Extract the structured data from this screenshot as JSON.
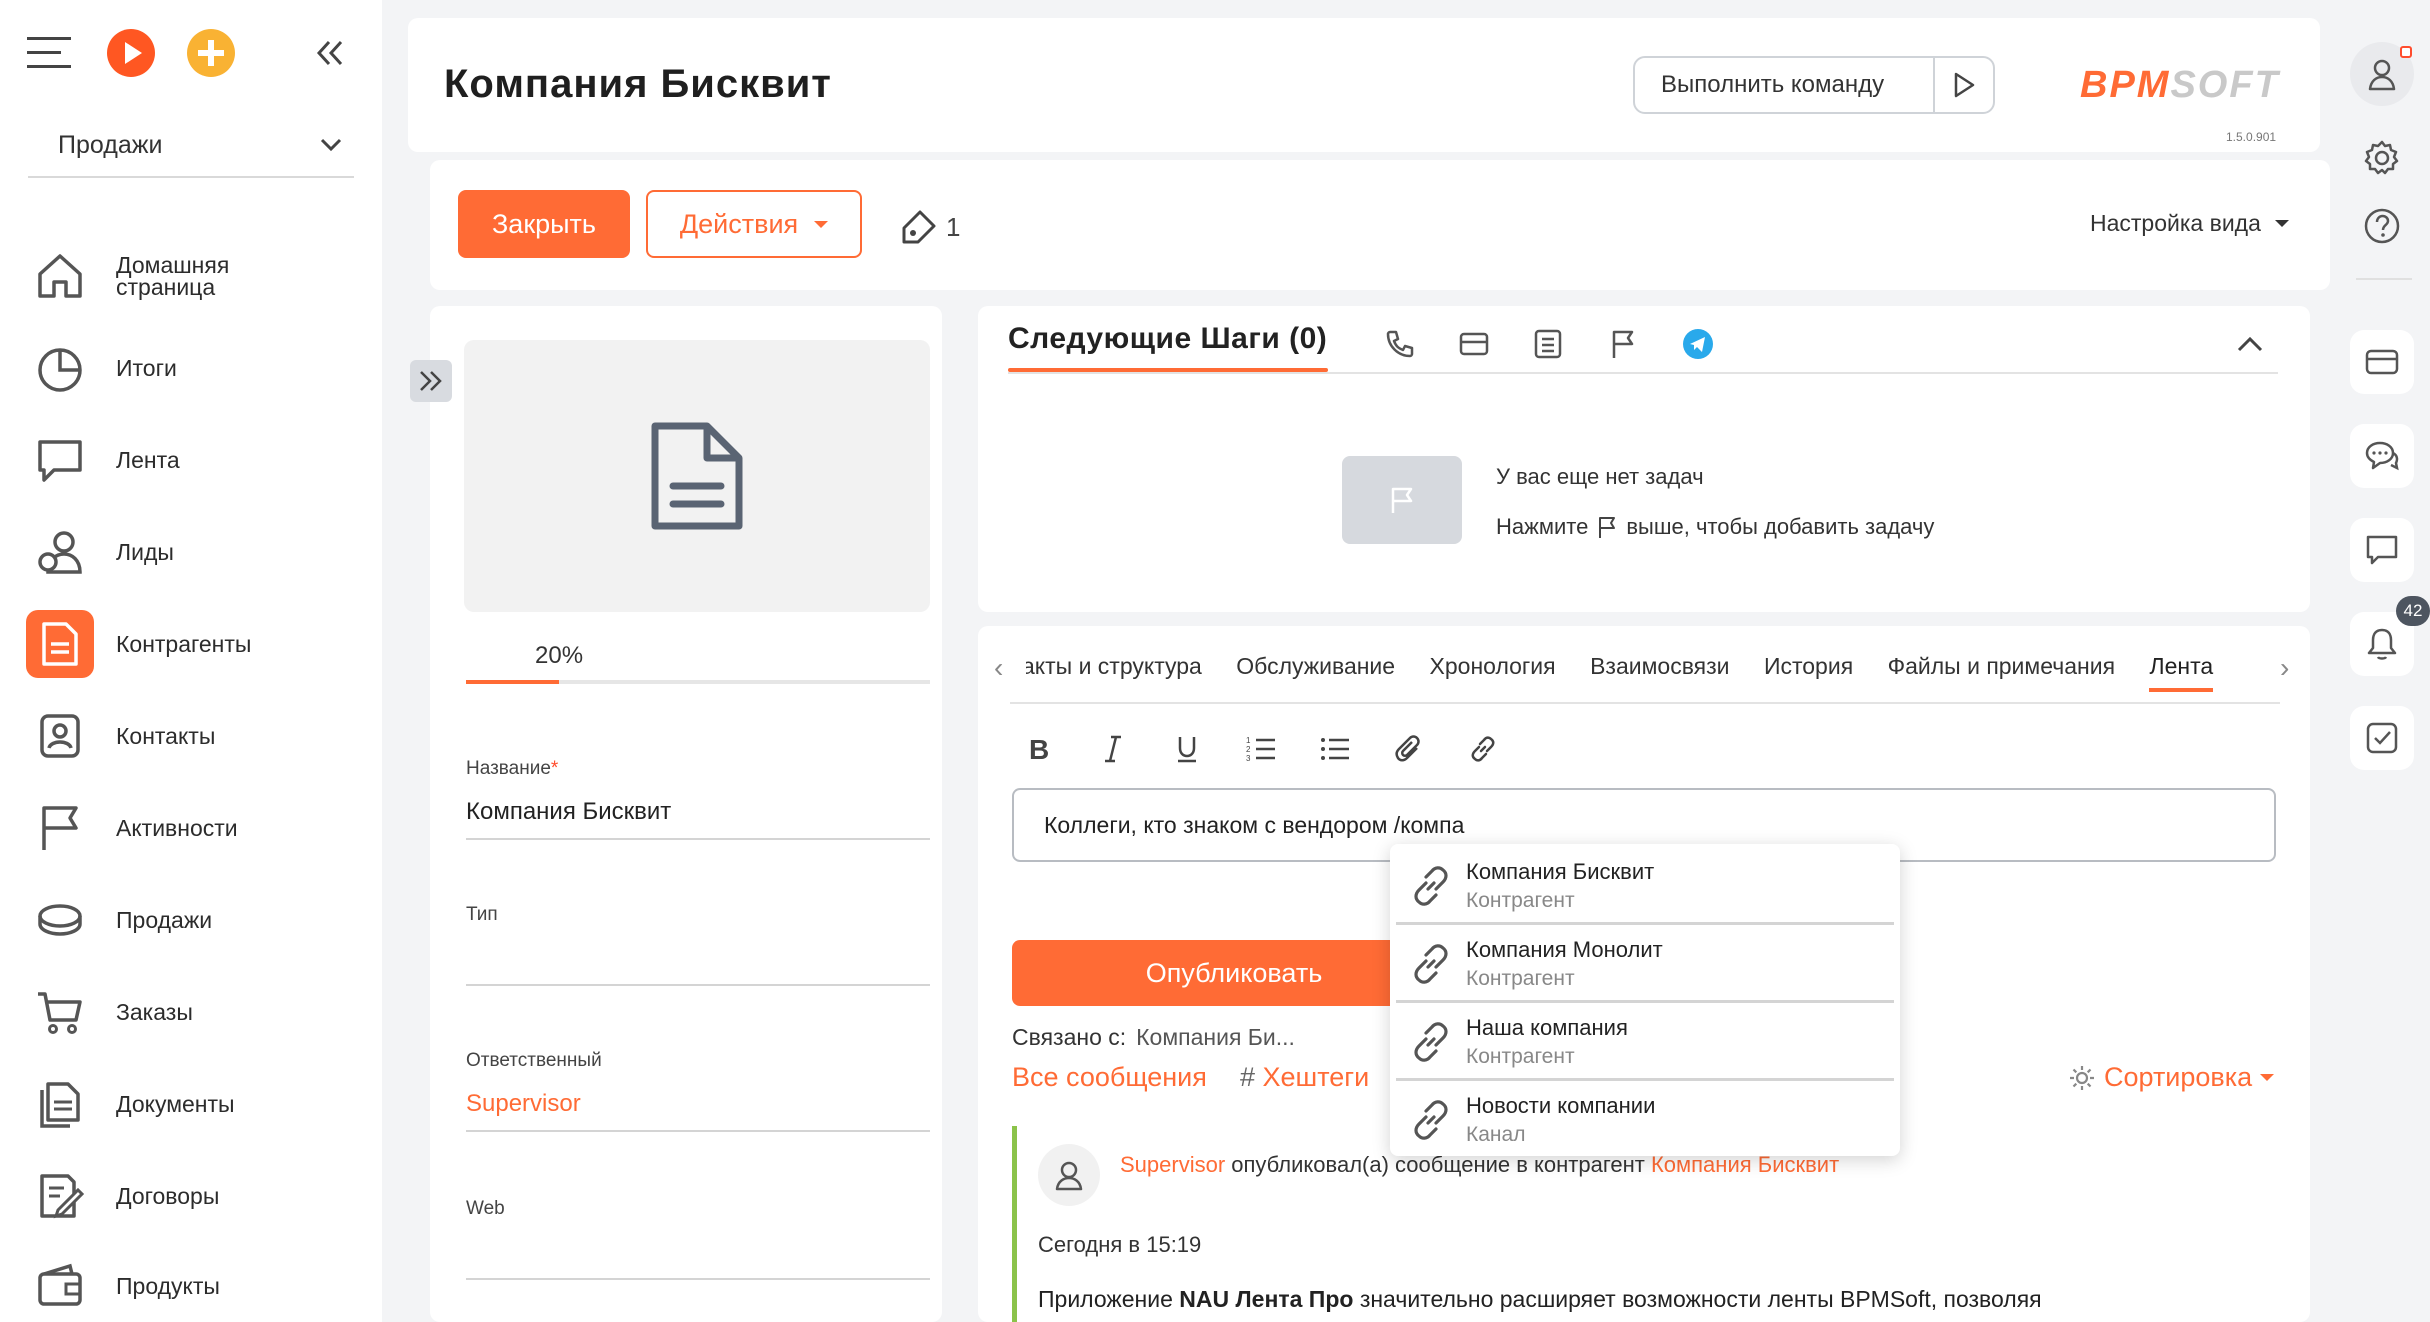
{
  "sidebar": {
    "section_select": "Продажи",
    "items": [
      {
        "label": "Домашняя\nстраница",
        "icon": "home-icon"
      },
      {
        "label": "Итоги",
        "icon": "pie-chart-icon"
      },
      {
        "label": "Лента",
        "icon": "chat-bubble-icon"
      },
      {
        "label": "Лиды",
        "icon": "leads-icon"
      },
      {
        "label": "Контрагенты",
        "icon": "document-icon"
      },
      {
        "label": "Контакты",
        "icon": "contact-card-icon"
      },
      {
        "label": "Активности",
        "icon": "flag-icon"
      },
      {
        "label": "Продажи",
        "icon": "coins-icon"
      },
      {
        "label": "Заказы",
        "icon": "cart-icon"
      },
      {
        "label": "Документы",
        "icon": "documents-icon"
      },
      {
        "label": "Договоры",
        "icon": "contract-icon"
      },
      {
        "label": "Продукты",
        "icon": "wallet-icon"
      }
    ],
    "active_item": "Контрагенты"
  },
  "header": {
    "title": "Компания Бисквит",
    "command_placeholder": "Выполнить команду",
    "logo_part1": "BPM",
    "logo_part2": "SOFT",
    "version": "1.5.0.901"
  },
  "toolbar": {
    "close_label": "Закрыть",
    "actions_label": "Действия",
    "tag_count": "1",
    "view_settings_label": "Настройка вида"
  },
  "profile": {
    "progress_label": "20%",
    "progress_fraction": 0.2,
    "fields": {
      "name_label": "Название",
      "name_value": "Компания Бисквит",
      "type_label": "Тип",
      "type_value": "",
      "owner_label": "Ответственный",
      "owner_value": "Supervisor",
      "web_label": "Web",
      "web_value": ""
    }
  },
  "next_steps": {
    "title": "Следующие Шаги (0)",
    "empty_line1": "У вас еще нет задач",
    "empty_line2_prefix": "Нажмите",
    "empty_line2_suffix": "выше, чтобы добавить задачу"
  },
  "feed": {
    "tabs": [
      "акты и структура",
      "Обслуживание",
      "Хронология",
      "Взаимосвязи",
      "История",
      "Файлы и примечания",
      "Лента"
    ],
    "active_tab": "Лента",
    "input_value": "Коллеги, кто знаком с вендором /компа",
    "publish_label": "Опубликовать",
    "linked_label": "Связано с:",
    "linked_value": "Компания Би...",
    "filter_all": "Все сообщения",
    "filter_hashtags": "Хештеги",
    "sort_label": "Сортировка",
    "post": {
      "author": "Supervisor",
      "action": "опубликовал(а) сообщение в контрагент",
      "target": "Компания Бисквит",
      "time": "Сегодня в 15:19",
      "body_prefix": "Приложение",
      "body_bold": "NAU Лента Про",
      "body_suffix": "значительно расширяет возможности ленты BPMSoft, позволяя"
    }
  },
  "mention_dropdown": [
    {
      "title": "Компания Бисквит",
      "subtitle": "Контрагент"
    },
    {
      "title": "Компания Монолит",
      "subtitle": "Контрагент"
    },
    {
      "title": "Наша компания",
      "subtitle": "Контрагент"
    },
    {
      "title": "Новости компании",
      "subtitle": "Канал"
    }
  ],
  "rail": {
    "notification_count": "42"
  },
  "colors": {
    "accent": "#ff6b35",
    "post_bar": "#8bc34a",
    "telegram": "#29a9eb"
  }
}
